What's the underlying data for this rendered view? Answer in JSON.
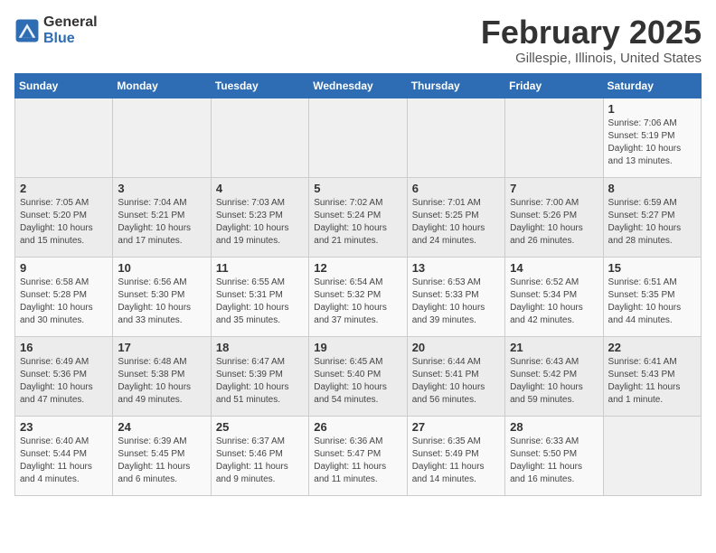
{
  "header": {
    "logo_line1": "General",
    "logo_line2": "Blue",
    "month": "February 2025",
    "location": "Gillespie, Illinois, United States"
  },
  "weekdays": [
    "Sunday",
    "Monday",
    "Tuesday",
    "Wednesday",
    "Thursday",
    "Friday",
    "Saturday"
  ],
  "weeks": [
    [
      {
        "day": "",
        "detail": ""
      },
      {
        "day": "",
        "detail": ""
      },
      {
        "day": "",
        "detail": ""
      },
      {
        "day": "",
        "detail": ""
      },
      {
        "day": "",
        "detail": ""
      },
      {
        "day": "",
        "detail": ""
      },
      {
        "day": "1",
        "detail": "Sunrise: 7:06 AM\nSunset: 5:19 PM\nDaylight: 10 hours\nand 13 minutes."
      }
    ],
    [
      {
        "day": "2",
        "detail": "Sunrise: 7:05 AM\nSunset: 5:20 PM\nDaylight: 10 hours\nand 15 minutes."
      },
      {
        "day": "3",
        "detail": "Sunrise: 7:04 AM\nSunset: 5:21 PM\nDaylight: 10 hours\nand 17 minutes."
      },
      {
        "day": "4",
        "detail": "Sunrise: 7:03 AM\nSunset: 5:23 PM\nDaylight: 10 hours\nand 19 minutes."
      },
      {
        "day": "5",
        "detail": "Sunrise: 7:02 AM\nSunset: 5:24 PM\nDaylight: 10 hours\nand 21 minutes."
      },
      {
        "day": "6",
        "detail": "Sunrise: 7:01 AM\nSunset: 5:25 PM\nDaylight: 10 hours\nand 24 minutes."
      },
      {
        "day": "7",
        "detail": "Sunrise: 7:00 AM\nSunset: 5:26 PM\nDaylight: 10 hours\nand 26 minutes."
      },
      {
        "day": "8",
        "detail": "Sunrise: 6:59 AM\nSunset: 5:27 PM\nDaylight: 10 hours\nand 28 minutes."
      }
    ],
    [
      {
        "day": "9",
        "detail": "Sunrise: 6:58 AM\nSunset: 5:28 PM\nDaylight: 10 hours\nand 30 minutes."
      },
      {
        "day": "10",
        "detail": "Sunrise: 6:56 AM\nSunset: 5:30 PM\nDaylight: 10 hours\nand 33 minutes."
      },
      {
        "day": "11",
        "detail": "Sunrise: 6:55 AM\nSunset: 5:31 PM\nDaylight: 10 hours\nand 35 minutes."
      },
      {
        "day": "12",
        "detail": "Sunrise: 6:54 AM\nSunset: 5:32 PM\nDaylight: 10 hours\nand 37 minutes."
      },
      {
        "day": "13",
        "detail": "Sunrise: 6:53 AM\nSunset: 5:33 PM\nDaylight: 10 hours\nand 39 minutes."
      },
      {
        "day": "14",
        "detail": "Sunrise: 6:52 AM\nSunset: 5:34 PM\nDaylight: 10 hours\nand 42 minutes."
      },
      {
        "day": "15",
        "detail": "Sunrise: 6:51 AM\nSunset: 5:35 PM\nDaylight: 10 hours\nand 44 minutes."
      }
    ],
    [
      {
        "day": "16",
        "detail": "Sunrise: 6:49 AM\nSunset: 5:36 PM\nDaylight: 10 hours\nand 47 minutes."
      },
      {
        "day": "17",
        "detail": "Sunrise: 6:48 AM\nSunset: 5:38 PM\nDaylight: 10 hours\nand 49 minutes."
      },
      {
        "day": "18",
        "detail": "Sunrise: 6:47 AM\nSunset: 5:39 PM\nDaylight: 10 hours\nand 51 minutes."
      },
      {
        "day": "19",
        "detail": "Sunrise: 6:45 AM\nSunset: 5:40 PM\nDaylight: 10 hours\nand 54 minutes."
      },
      {
        "day": "20",
        "detail": "Sunrise: 6:44 AM\nSunset: 5:41 PM\nDaylight: 10 hours\nand 56 minutes."
      },
      {
        "day": "21",
        "detail": "Sunrise: 6:43 AM\nSunset: 5:42 PM\nDaylight: 10 hours\nand 59 minutes."
      },
      {
        "day": "22",
        "detail": "Sunrise: 6:41 AM\nSunset: 5:43 PM\nDaylight: 11 hours\nand 1 minute."
      }
    ],
    [
      {
        "day": "23",
        "detail": "Sunrise: 6:40 AM\nSunset: 5:44 PM\nDaylight: 11 hours\nand 4 minutes."
      },
      {
        "day": "24",
        "detail": "Sunrise: 6:39 AM\nSunset: 5:45 PM\nDaylight: 11 hours\nand 6 minutes."
      },
      {
        "day": "25",
        "detail": "Sunrise: 6:37 AM\nSunset: 5:46 PM\nDaylight: 11 hours\nand 9 minutes."
      },
      {
        "day": "26",
        "detail": "Sunrise: 6:36 AM\nSunset: 5:47 PM\nDaylight: 11 hours\nand 11 minutes."
      },
      {
        "day": "27",
        "detail": "Sunrise: 6:35 AM\nSunset: 5:49 PM\nDaylight: 11 hours\nand 14 minutes."
      },
      {
        "day": "28",
        "detail": "Sunrise: 6:33 AM\nSunset: 5:50 PM\nDaylight: 11 hours\nand 16 minutes."
      },
      {
        "day": "",
        "detail": ""
      }
    ]
  ]
}
